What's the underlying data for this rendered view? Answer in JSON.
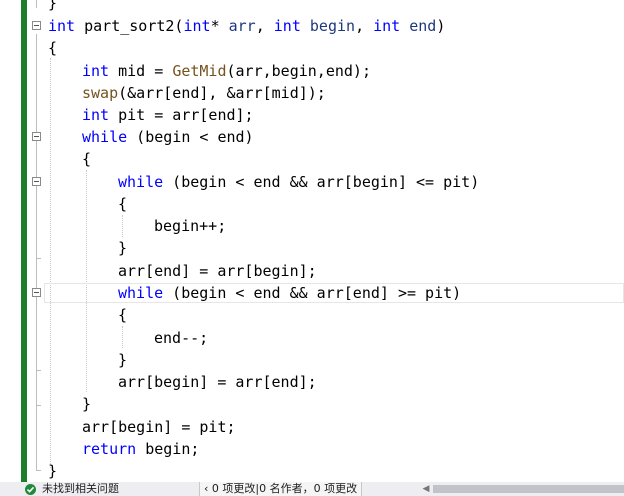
{
  "editor": {
    "lines": {
      "l0": "}",
      "l1_a": "int",
      "l1_b": " part_sort2(",
      "l1_c": "int",
      "l1_d": "* ",
      "l1_e": "arr",
      "l1_f": ", ",
      "l1_g": "int",
      "l1_h": " ",
      "l1_i": "begin",
      "l1_j": ", ",
      "l1_k": "int",
      "l1_l": " ",
      "l1_m": "end",
      "l1_n": ")",
      "l2": "{",
      "l3_a": "int",
      "l3_b": " mid = ",
      "l3_c": "GetMid",
      "l3_d": "(arr,begin,end);",
      "l4_a": "swap",
      "l4_b": "(&arr[end], &arr[mid]);",
      "l5_a": "int",
      "l5_b": " pit = arr[end];",
      "l6_a": "while",
      "l6_b": " (begin < end)",
      "l7": "{",
      "l8_a": "while",
      "l8_b": " (begin < end && arr[begin] <= pit)",
      "l9": "{",
      "l10": "begin++;",
      "l11": "}",
      "l12": "arr[end] = arr[begin];",
      "l13_a": "while",
      "l13_b": " (begin < end && arr[end] >= pit)",
      "l14": "{",
      "l15": "end--;",
      "l16": "}",
      "l17": "arr[begin] = arr[end];",
      "l18": "}",
      "l19": "arr[begin] = pit;",
      "l20_a": "return",
      "l20_b": " begin;",
      "l21": "}"
    }
  },
  "status": {
    "icon": "check-circle-icon",
    "message": "未找到相关问题",
    "changes": "‹ 0 项更改|0 名作者，0 项更改"
  },
  "colors": {
    "keyword": "#0000ff",
    "function": "#74531f",
    "gutter_bar": "#1e7d2c"
  }
}
